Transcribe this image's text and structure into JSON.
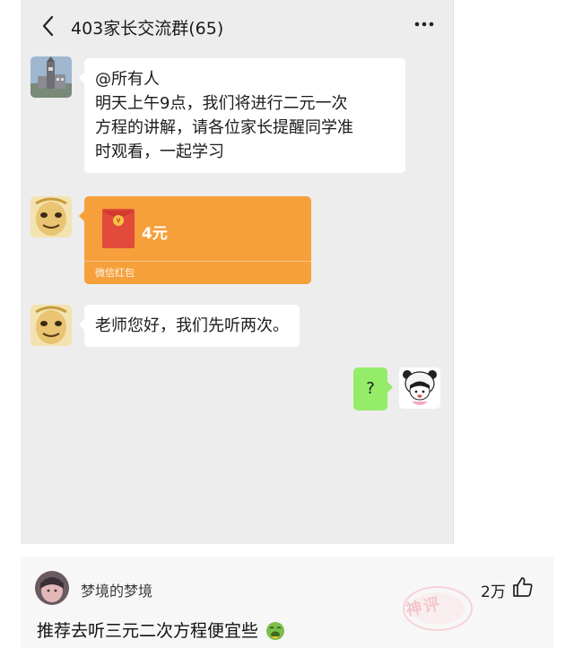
{
  "header": {
    "title": "403家长交流群(65)",
    "back_icon": "chevron-left-icon",
    "more_icon": "more-dots-icon"
  },
  "messages": [
    {
      "sender": "other",
      "avatar": "building-photo-avatar",
      "lines": [
        "@所有人",
        "明天上午9点，我们将进行二元一次",
        "方程的讲解，请各位家长提醒同学准",
        "时观看，一起学习"
      ]
    },
    {
      "sender": "other",
      "avatar": "meme-face-avatar",
      "type": "red-packet",
      "amount": "4元",
      "label": "微信红包",
      "color": "#f6a03b"
    },
    {
      "sender": "other",
      "avatar": "meme-face-avatar",
      "text": "老师您好，我们先听两次。"
    },
    {
      "sender": "self",
      "avatar": "panda-hat-girl-avatar",
      "text": "?",
      "color": "#95ec69"
    }
  ],
  "comment": {
    "username": "梦境的梦境",
    "likes": "2万",
    "text": "推荐去听三元二次方程便宜些",
    "emoji": "vomit-face-emoji",
    "watermark": "神评"
  }
}
